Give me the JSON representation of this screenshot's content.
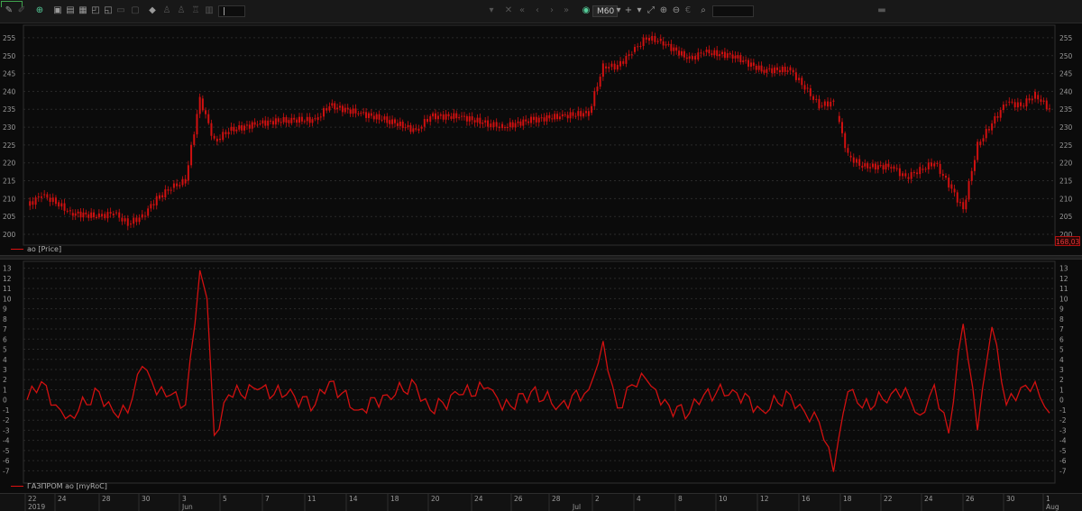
{
  "toolbar": {
    "timeframe_value": "M60",
    "field_value": "|",
    "icons": [
      "line-tool-icon",
      "draw-tool-icon",
      "add-chart-icon",
      "save-layout-icon",
      "layout-icon",
      "table-icon",
      "new-window-icon",
      "lock-icon",
      "comment-icon",
      "flag-icon",
      "scale-icon",
      "indicator-icon",
      "prev-icon",
      "next-icon",
      "crosshair-icon",
      "fit-icon",
      "zoom-in-icon",
      "zoom-out-icon",
      "currency-icon",
      "search-icon",
      "menu-icon"
    ]
  },
  "price_panel": {
    "legend": "ao [Price]",
    "last_price_badge": "168,03",
    "y_ticks": [
      "255",
      "250",
      "245",
      "240",
      "235",
      "230",
      "225",
      "220",
      "215",
      "210",
      "205",
      "200"
    ]
  },
  "indicator_panel": {
    "legend": "ГАЗПРОМ ао [myRoC]",
    "y_ticks": [
      "13",
      "12",
      "11",
      "10",
      "9",
      "8",
      "7",
      "6",
      "5",
      "4",
      "3",
      "2",
      "1",
      "0",
      "-1",
      "-2",
      "-3",
      "-4",
      "-5",
      "-6",
      "-7"
    ]
  },
  "x_axis": {
    "day_labels": [
      "22",
      "24",
      "28",
      "30",
      "3",
      "5",
      "7",
      "11",
      "14",
      "18",
      "20",
      "24",
      "26",
      "28",
      "2",
      "4",
      "8",
      "10",
      "12",
      "16",
      "18",
      "22",
      "24",
      "26",
      "30",
      "1"
    ],
    "month_labels": [
      "2019",
      "Jun",
      "Jul",
      "Aug"
    ]
  },
  "colors": {
    "series": "#d01010",
    "background": "#0b0b0b",
    "grid": "#2b2b2b"
  },
  "chart_data": [
    {
      "type": "candlestick",
      "title": "ao [Price]",
      "ylim": [
        199,
        257
      ],
      "x_range": [
        "2019-05-22",
        "2019-08-01"
      ],
      "grid": true,
      "series": [
        {
          "name": "ao [Price]",
          "points": [
            [
              "2019-05-22",
              208
            ],
            [
              "2019-05-23",
              211
            ],
            [
              "2019-05-24",
              209
            ],
            [
              "2019-05-25",
              206
            ],
            [
              "2019-05-27",
              205
            ],
            [
              "2019-05-28",
              206
            ],
            [
              "2019-05-29",
              203
            ],
            [
              "2019-05-30",
              205
            ],
            [
              "2019-05-31",
              210
            ],
            [
              "2019-06-01",
              213
            ],
            [
              "2019-06-02",
              215
            ],
            [
              "2019-06-03",
              238
            ],
            [
              "2019-06-04",
              226
            ],
            [
              "2019-06-05",
              229
            ],
            [
              "2019-06-07",
              231
            ],
            [
              "2019-06-09",
              232
            ],
            [
              "2019-06-11",
              232
            ],
            [
              "2019-06-12",
              236
            ],
            [
              "2019-06-14",
              234
            ],
            [
              "2019-06-16",
              232
            ],
            [
              "2019-06-18",
              229
            ],
            [
              "2019-06-19",
              233
            ],
            [
              "2019-06-21",
              233
            ],
            [
              "2019-06-23",
              231
            ],
            [
              "2019-06-24",
              230
            ],
            [
              "2019-06-26",
              232
            ],
            [
              "2019-06-28",
              233
            ],
            [
              "2019-06-30",
              234
            ],
            [
              "2019-07-01",
              247
            ],
            [
              "2019-07-02",
              247
            ],
            [
              "2019-07-03",
              251
            ],
            [
              "2019-07-04",
              255
            ],
            [
              "2019-07-05",
              254
            ],
            [
              "2019-07-07",
              249
            ],
            [
              "2019-07-08",
              251
            ],
            [
              "2019-07-10",
              250
            ],
            [
              "2019-07-12",
              246
            ],
            [
              "2019-07-14",
              246
            ],
            [
              "2019-07-15",
              241
            ],
            [
              "2019-07-16",
              236
            ],
            [
              "2019-07-17",
              237
            ],
            [
              "2019-07-18",
              222
            ],
            [
              "2019-07-19",
              219
            ],
            [
              "2019-07-21",
              219
            ],
            [
              "2019-07-22",
              216
            ],
            [
              "2019-07-23",
              218
            ],
            [
              "2019-07-24",
              220
            ],
            [
              "2019-07-25",
              214
            ],
            [
              "2019-07-26",
              207
            ],
            [
              "2019-07-27",
              225
            ],
            [
              "2019-07-28",
              231
            ],
            [
              "2019-07-29",
              237
            ],
            [
              "2019-07-30",
              236
            ],
            [
              "2019-07-31",
              239
            ],
            [
              "2019-08-01",
              235
            ]
          ]
        }
      ]
    },
    {
      "type": "line",
      "title": "ГАЗПРОМ ао [myRoC]",
      "ylim": [
        -7.5,
        13.5
      ],
      "x_range": [
        "2019-05-22",
        "2019-08-01"
      ],
      "grid": true,
      "series": [
        {
          "name": "ГАЗПРОМ ао [myRoC]",
          "points": [
            [
              "2019-05-22",
              0
            ],
            [
              "2019-05-23",
              1.8
            ],
            [
              "2019-05-24",
              -0.5
            ],
            [
              "2019-05-25",
              -1.5
            ],
            [
              "2019-05-27",
              0.8
            ],
            [
              "2019-05-28",
              -1.2
            ],
            [
              "2019-05-29",
              -1.3
            ],
            [
              "2019-05-30",
              3.3
            ],
            [
              "2019-05-31",
              0.5
            ],
            [
              "2019-06-01",
              0.5
            ],
            [
              "2019-06-02",
              -0.5
            ],
            [
              "2019-06-03",
              12.8
            ],
            [
              "2019-06-03T12",
              10
            ],
            [
              "2019-06-04",
              -3.5
            ],
            [
              "2019-06-05",
              0.5
            ],
            [
              "2019-06-07",
              1
            ],
            [
              "2019-06-09",
              0.5
            ],
            [
              "2019-06-11",
              -0.5
            ],
            [
              "2019-06-12",
              1.8
            ],
            [
              "2019-06-14",
              -1
            ],
            [
              "2019-06-16",
              0.5
            ],
            [
              "2019-06-18",
              1.5
            ],
            [
              "2019-06-19",
              -1
            ],
            [
              "2019-06-21",
              0.5
            ],
            [
              "2019-06-23",
              1.2
            ],
            [
              "2019-06-24",
              -1
            ],
            [
              "2019-06-26",
              0.8
            ],
            [
              "2019-06-28",
              -0.5
            ],
            [
              "2019-06-30",
              1
            ],
            [
              "2019-07-01",
              5.8
            ],
            [
              "2019-07-02",
              -0.8
            ],
            [
              "2019-07-03",
              1.5
            ],
            [
              "2019-07-04",
              2
            ],
            [
              "2019-07-05",
              -0.5
            ],
            [
              "2019-07-07",
              -1.3
            ],
            [
              "2019-07-08",
              0.5
            ],
            [
              "2019-07-10",
              1
            ],
            [
              "2019-07-12",
              -1
            ],
            [
              "2019-07-14",
              0.5
            ],
            [
              "2019-07-15",
              -1.2
            ],
            [
              "2019-07-16",
              -2.2
            ],
            [
              "2019-07-17",
              -7.1
            ],
            [
              "2019-07-18",
              0.8
            ],
            [
              "2019-07-19",
              -0.8
            ],
            [
              "2019-07-21",
              0.6
            ],
            [
              "2019-07-22",
              1.2
            ],
            [
              "2019-07-23",
              -1.5
            ],
            [
              "2019-07-24",
              1.5
            ],
            [
              "2019-07-25",
              -3.3
            ],
            [
              "2019-07-26",
              7.5
            ],
            [
              "2019-07-27",
              -3
            ],
            [
              "2019-07-28",
              7.2
            ],
            [
              "2019-07-29",
              -0.5
            ],
            [
              "2019-07-30",
              1.2
            ],
            [
              "2019-07-31",
              1.8
            ],
            [
              "2019-08-01",
              -1.3
            ]
          ]
        }
      ]
    }
  ]
}
